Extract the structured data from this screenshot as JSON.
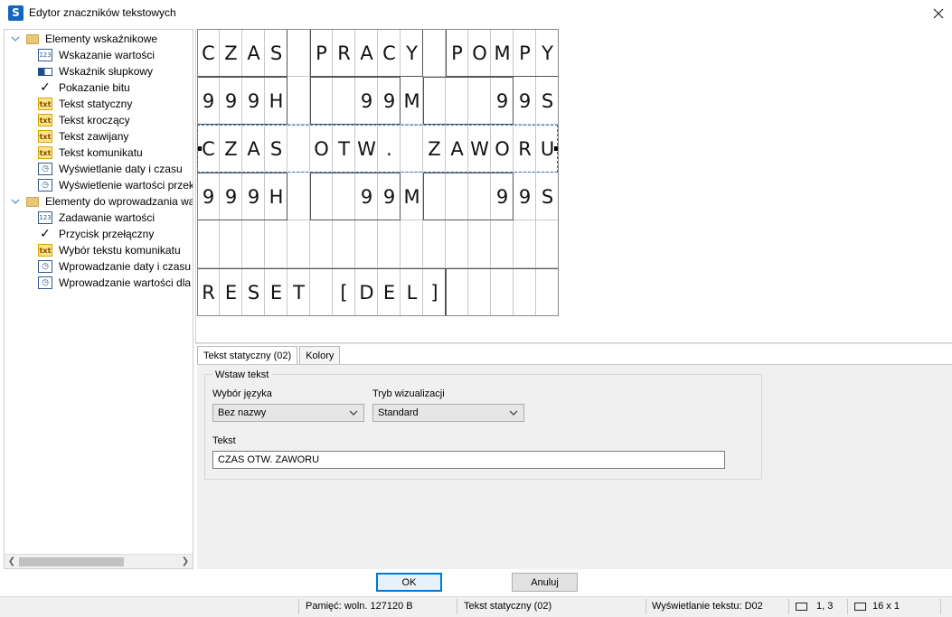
{
  "window": {
    "title": "Edytor znaczników tekstowych",
    "app_icon": "S"
  },
  "tree": {
    "groups": [
      {
        "label": "Elementy wskaźnikowe",
        "icon": "folder-icon",
        "items": [
          {
            "label": "Wskazanie wartości",
            "icon": "numeric-display-icon",
            "glyph": "123"
          },
          {
            "label": "Wskaźnik słupkowy",
            "icon": "bar-indicator-icon",
            "glyph": ""
          },
          {
            "label": "Pokazanie bitu",
            "icon": "checkmark-icon",
            "glyph": "✓"
          },
          {
            "label": "Tekst statyczny",
            "icon": "static-text-icon",
            "glyph": "txt"
          },
          {
            "label": "Tekst kroczący",
            "icon": "scrolling-text-icon",
            "glyph": "txt"
          },
          {
            "label": "Tekst zawijany",
            "icon": "wrapped-text-icon",
            "glyph": "txt"
          },
          {
            "label": "Tekst komunikatu",
            "icon": "message-text-icon",
            "glyph": "txt"
          },
          {
            "label": "Wyświetlanie daty i czasu",
            "icon": "date-time-icon",
            "glyph": "◷"
          },
          {
            "label": "Wyświetlenie wartości przeka",
            "icon": "value-display-icon",
            "glyph": "◷"
          }
        ]
      },
      {
        "label": "Elementy do wprowadzania war",
        "icon": "folder-icon",
        "items": [
          {
            "label": "Zadawanie wartości",
            "icon": "numeric-input-icon",
            "glyph": "123"
          },
          {
            "label": "Przycisk przełączny",
            "icon": "toggle-button-icon",
            "glyph": "✓"
          },
          {
            "label": "Wybór tekstu komunikatu",
            "icon": "message-select-icon",
            "glyph": "txt"
          },
          {
            "label": "Wprowadzanie daty i czasu",
            "icon": "date-time-input-icon",
            "glyph": "◷"
          },
          {
            "label": "Wprowadzanie wartości dla p",
            "icon": "value-input-icon",
            "glyph": "◷"
          }
        ]
      }
    ]
  },
  "display": {
    "rows": [
      {
        "text": "CZAS PRACY POMPY",
        "chars": [
          "C",
          "Z",
          "A",
          "S",
          "",
          "P",
          "R",
          "A",
          "C",
          "Y",
          "",
          "P",
          "O",
          "M",
          "P",
          "Y"
        ],
        "boxes": [
          [
            0,
            4
          ],
          [
            5,
            10
          ],
          [
            11,
            16
          ]
        ]
      },
      {
        "text": "999H 99M 99S",
        "chars": [
          "9",
          "9",
          "9",
          "H",
          "",
          "",
          "",
          "9",
          "9",
          "M",
          "",
          "",
          "",
          "9",
          "9",
          "S"
        ],
        "boxes": [
          [
            0,
            4
          ],
          [
            5,
            9
          ],
          [
            10,
            14
          ]
        ]
      },
      {
        "text": "CZAS OTW. ZAWORU",
        "chars": [
          "C",
          "Z",
          "A",
          "S",
          "",
          "O",
          "T",
          "W",
          ".",
          "",
          "Z",
          "A",
          "W",
          "O",
          "R",
          "U"
        ],
        "boxes": []
      },
      {
        "text": "999H 99M 99S",
        "chars": [
          "9",
          "9",
          "9",
          "H",
          "",
          "",
          "",
          "9",
          "9",
          "M",
          "",
          "",
          "",
          "9",
          "9",
          "S"
        ],
        "boxes": [
          [
            0,
            4
          ],
          [
            5,
            9
          ],
          [
            10,
            14
          ]
        ]
      },
      {
        "text": "",
        "chars": [
          "",
          "",
          "",
          "",
          "",
          "",
          "",
          "",
          "",
          "",
          "",
          "",
          "",
          "",
          "",
          ""
        ],
        "boxes": []
      },
      {
        "text": "RESET [DEL]",
        "chars": [
          "R",
          "E",
          "S",
          "E",
          "T",
          "",
          "[",
          "D",
          "E",
          "L",
          "]",
          "",
          "",
          "",
          "",
          ""
        ],
        "boxes": [
          [
            0,
            11
          ],
          [
            11,
            16
          ]
        ]
      }
    ]
  },
  "tabs": [
    {
      "label": "Tekst statyczny (02)",
      "active": true
    },
    {
      "label": "Kolory",
      "active": false
    }
  ],
  "form": {
    "group_label": "Wstaw tekst",
    "language_label": "Wybór języka",
    "language_value": "Bez nazwy",
    "mode_label": "Tryb wizualizacji",
    "mode_value": "Standard",
    "text_label": "Tekst",
    "text_value": "CZAS OTW. ZAWORU"
  },
  "buttons": {
    "ok": "OK",
    "cancel": "Anuluj"
  },
  "status": {
    "memory": "Pamięć: woln. 127120 B",
    "element": "Tekst statyczny (02)",
    "display": "Wyświetlanie tekstu: D02",
    "position": "1, 3",
    "size": "16 x 1"
  }
}
